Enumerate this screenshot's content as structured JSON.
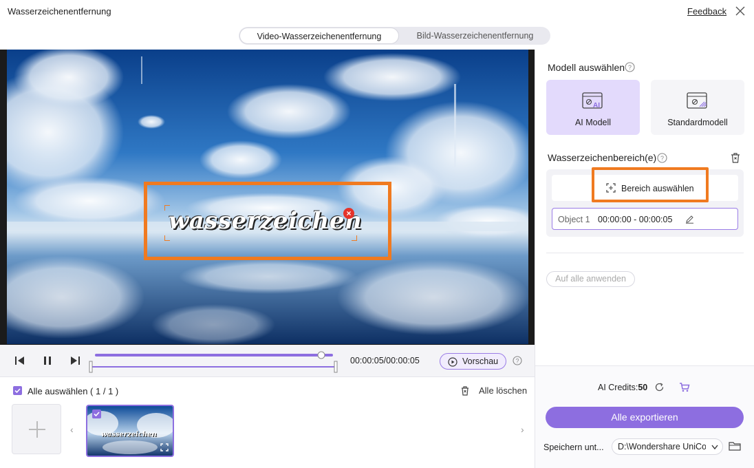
{
  "window": {
    "title": "Wasserzeichenentfernung",
    "feedback_label": "Feedback",
    "close_icon": "close-icon"
  },
  "tabs": [
    {
      "label": "Video-Wasserzeichenentfernung",
      "active": true
    },
    {
      "label": "Bild-Wasserzeichenentfernung",
      "active": false
    }
  ],
  "video": {
    "watermark_text": "wasserzeichen",
    "highlight_color": "#f07a20"
  },
  "playback": {
    "current_time": "00:00:05",
    "total_time": "00:00:05",
    "time_display": "00:00:05/00:00:05",
    "progress": 1.0,
    "preview_label": "Vorschau"
  },
  "file_list": {
    "select_all_label": "Alle auswählen ( 1 / 1 )",
    "delete_all_label": "Alle löschen",
    "thumbnail_watermark": "wasserzeichen"
  },
  "sidebar": {
    "model_title": "Modell auswählen",
    "models": [
      {
        "label": "AI Modell",
        "selected": true
      },
      {
        "label": "Standardmodell",
        "selected": false
      }
    ],
    "area_title": "Wasserzeichenbereich(e)",
    "select_area_label": "Bereich auswählen",
    "objects": [
      {
        "name": "Object 1",
        "time": "00:00:00 - 00:00:05"
      }
    ],
    "apply_all_label": "Auf alle anwenden",
    "credits_label": "AI Credits:",
    "credits_value": "50",
    "export_label": "Alle exportieren",
    "save_label": "Speichern unt...",
    "save_path": "D:\\Wondershare UniCon"
  },
  "colors": {
    "accent": "#8d6ee0",
    "accent_light": "#e3dafc",
    "highlight": "#f07a20"
  }
}
